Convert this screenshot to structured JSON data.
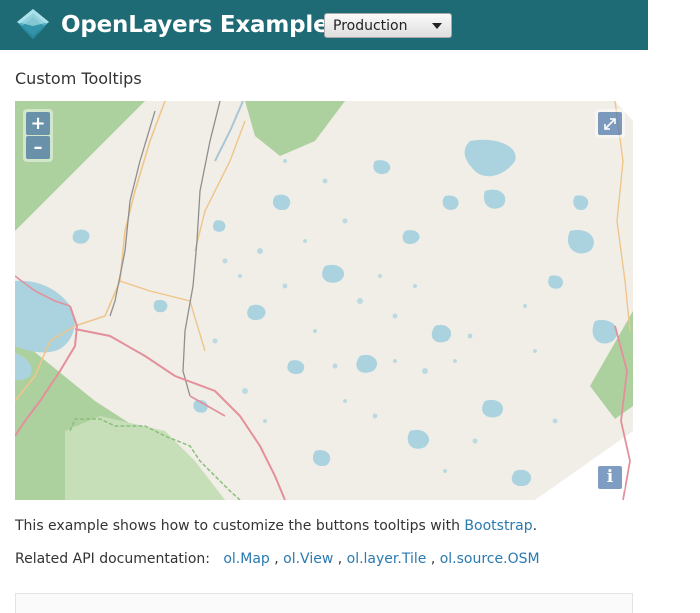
{
  "header": {
    "brand": "OpenLayers Examples",
    "version_select": {
      "selected": "Production"
    },
    "colors": {
      "navbar_background": "#1f6b75",
      "logo_primary": "#4fb0c4"
    }
  },
  "page": {
    "title": "Custom Tooltips"
  },
  "map": {
    "zoom_in_label": "+",
    "zoom_out_label": "–",
    "fullscreen_icon": "expand-arrows-icon",
    "attribution_label": "i"
  },
  "description": {
    "text": "This example shows how to customize the buttons tooltips with ",
    "link_label": "Bootstrap",
    "suffix": "."
  },
  "related": {
    "label": "Related API documentation:",
    "links": [
      "ol.Map",
      "ol.View",
      "ol.layer.Tile",
      "ol.source.OSM"
    ],
    "separator": ","
  },
  "colors": {
    "link": "#2a7ab0",
    "map_land": "#f1eee8",
    "map_water": "#aad3df",
    "map_forest": "#add19e",
    "control_button": "rgba(0,60,136,0.5)"
  }
}
